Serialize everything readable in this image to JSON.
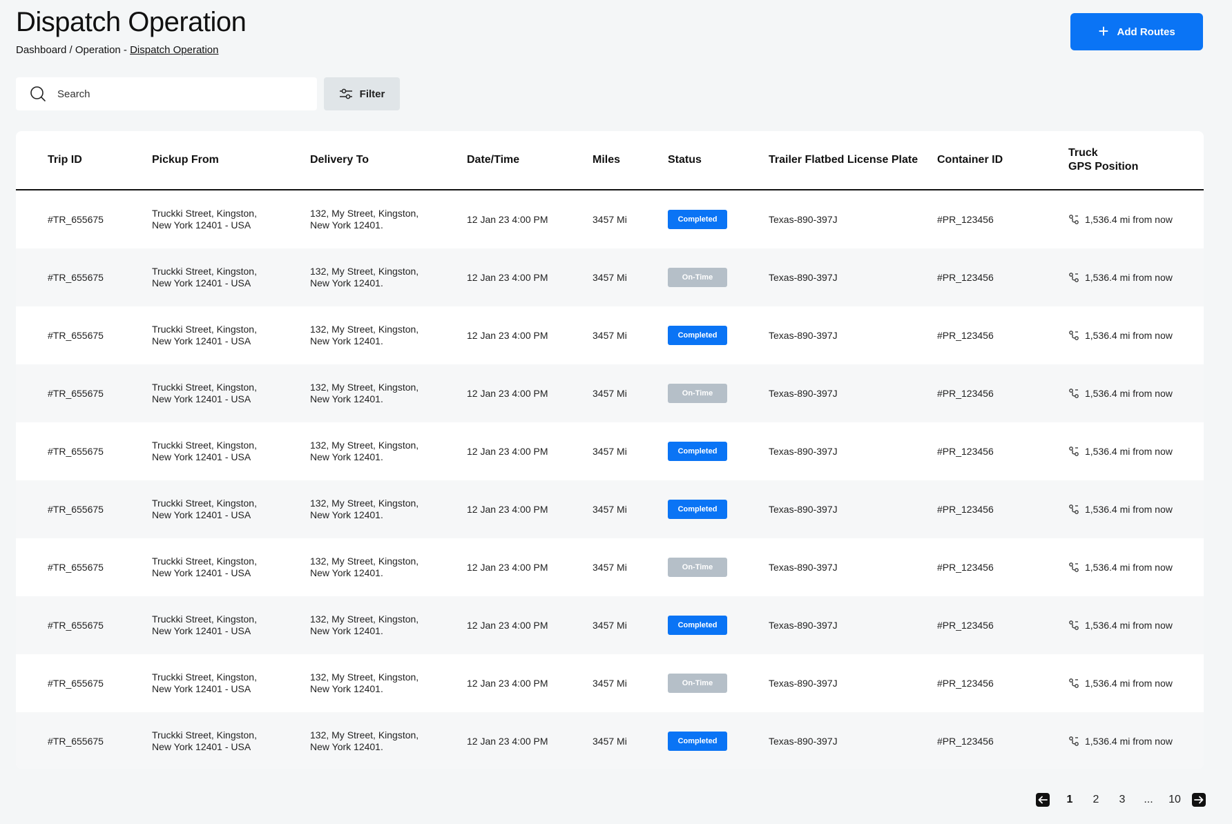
{
  "header": {
    "title": "Dispatch Operation",
    "breadcrumb_prefix": "Dashboard / Operation - ",
    "breadcrumb_current": "Dispatch Operation",
    "add_button_label": "Add Routes"
  },
  "toolbar": {
    "search_placeholder": "Search",
    "filter_label": "Filter"
  },
  "table": {
    "columns": [
      "Trip ID",
      "Pickup From",
      "Delivery To",
      "Date/Time",
      "Miles",
      "Status",
      "Trailer Flatbed License Plate",
      "Container ID",
      "Truck\nGPS Position"
    ],
    "rows": [
      {
        "trip_id": "#TR_655675",
        "pickup_line1": "Truckki Street, Kingston,",
        "pickup_line2": "New York 12401 - USA",
        "delivery_line1": "132, My Street, Kingston,",
        "delivery_line2": "New York 12401.",
        "datetime": "12 Jan 23 4:00 PM",
        "miles": "3457 Mi",
        "status": "Completed",
        "status_type": "completed",
        "plate": "Texas-890-397J",
        "container": "#PR_123456",
        "gps": "1,536.4 mi from now"
      },
      {
        "trip_id": "#TR_655675",
        "pickup_line1": "Truckki Street, Kingston,",
        "pickup_line2": "New York 12401 - USA",
        "delivery_line1": "132, My Street, Kingston,",
        "delivery_line2": "New York 12401.",
        "datetime": "12 Jan 23 4:00 PM",
        "miles": "3457 Mi",
        "status": "On-Time",
        "status_type": "ontime",
        "plate": "Texas-890-397J",
        "container": "#PR_123456",
        "gps": "1,536.4 mi from now"
      },
      {
        "trip_id": "#TR_655675",
        "pickup_line1": "Truckki Street, Kingston,",
        "pickup_line2": "New York 12401 - USA",
        "delivery_line1": "132, My Street, Kingston,",
        "delivery_line2": "New York 12401.",
        "datetime": "12 Jan 23 4:00 PM",
        "miles": "3457 Mi",
        "status": "Completed",
        "status_type": "completed",
        "plate": "Texas-890-397J",
        "container": "#PR_123456",
        "gps": "1,536.4 mi from now"
      },
      {
        "trip_id": "#TR_655675",
        "pickup_line1": "Truckki Street, Kingston,",
        "pickup_line2": "New York 12401 - USA",
        "delivery_line1": "132, My Street, Kingston,",
        "delivery_line2": "New York 12401.",
        "datetime": "12 Jan 23 4:00 PM",
        "miles": "3457 Mi",
        "status": "On-Time",
        "status_type": "ontime",
        "plate": "Texas-890-397J",
        "container": "#PR_123456",
        "gps": "1,536.4 mi from now"
      },
      {
        "trip_id": "#TR_655675",
        "pickup_line1": "Truckki Street, Kingston,",
        "pickup_line2": "New York 12401 - USA",
        "delivery_line1": "132, My Street, Kingston,",
        "delivery_line2": "New York 12401.",
        "datetime": "12 Jan 23 4:00 PM",
        "miles": "3457 Mi",
        "status": "Completed",
        "status_type": "completed",
        "plate": "Texas-890-397J",
        "container": "#PR_123456",
        "gps": "1,536.4 mi from now"
      },
      {
        "trip_id": "#TR_655675",
        "pickup_line1": "Truckki Street, Kingston,",
        "pickup_line2": "New York 12401 - USA",
        "delivery_line1": "132, My Street, Kingston,",
        "delivery_line2": "New York 12401.",
        "datetime": "12 Jan 23 4:00 PM",
        "miles": "3457 Mi",
        "status": "Completed",
        "status_type": "completed",
        "plate": "Texas-890-397J",
        "container": "#PR_123456",
        "gps": "1,536.4 mi from now"
      },
      {
        "trip_id": "#TR_655675",
        "pickup_line1": "Truckki Street, Kingston,",
        "pickup_line2": "New York 12401 - USA",
        "delivery_line1": "132, My Street, Kingston,",
        "delivery_line2": "New York 12401.",
        "datetime": "12 Jan 23 4:00 PM",
        "miles": "3457 Mi",
        "status": "On-Time",
        "status_type": "ontime",
        "plate": "Texas-890-397J",
        "container": "#PR_123456",
        "gps": "1,536.4 mi from now"
      },
      {
        "trip_id": "#TR_655675",
        "pickup_line1": "Truckki Street, Kingston,",
        "pickup_line2": "New York 12401 - USA",
        "delivery_line1": "132, My Street, Kingston,",
        "delivery_line2": "New York 12401.",
        "datetime": "12 Jan 23 4:00 PM",
        "miles": "3457 Mi",
        "status": "Completed",
        "status_type": "completed",
        "plate": "Texas-890-397J",
        "container": "#PR_123456",
        "gps": "1,536.4 mi from now"
      },
      {
        "trip_id": "#TR_655675",
        "pickup_line1": "Truckki Street, Kingston,",
        "pickup_line2": "New York 12401 - USA",
        "delivery_line1": "132, My Street, Kingston,",
        "delivery_line2": "New York 12401.",
        "datetime": "12 Jan 23 4:00 PM",
        "miles": "3457 Mi",
        "status": "On-Time",
        "status_type": "ontime",
        "plate": "Texas-890-397J",
        "container": "#PR_123456",
        "gps": "1,536.4 mi from now"
      },
      {
        "trip_id": "#TR_655675",
        "pickup_line1": "Truckki Street, Kingston,",
        "pickup_line2": "New York 12401 - USA",
        "delivery_line1": "132, My Street, Kingston,",
        "delivery_line2": "New York 12401.",
        "datetime": "12 Jan 23 4:00 PM",
        "miles": "3457 Mi",
        "status": "Completed",
        "status_type": "completed",
        "plate": "Texas-890-397J",
        "container": "#PR_123456",
        "gps": "1,536.4 mi from now"
      }
    ]
  },
  "pagination": {
    "pages": [
      "1",
      "2",
      "3",
      "...",
      "10"
    ],
    "current": "1"
  },
  "colors": {
    "accent": "#0a74f5",
    "status_completed": "#0a74f5",
    "status_ontime": "#b5bfc8",
    "background": "#f4f6f7"
  },
  "icons": {
    "add": "plus-icon",
    "search": "search-icon",
    "filter": "sliders-icon",
    "gps": "route-icon",
    "prev": "arrow-left-icon",
    "next": "arrow-right-icon"
  }
}
